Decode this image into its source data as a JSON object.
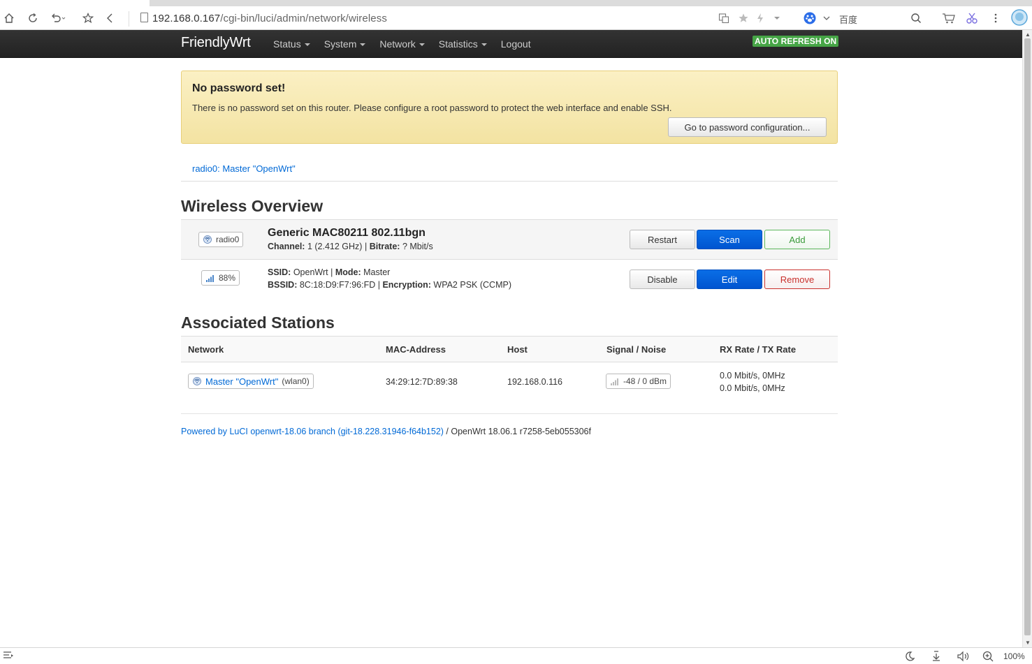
{
  "browser": {
    "url_host": "192.168.0.167",
    "url_path": "/cgi-bin/luci/admin/network/wireless",
    "search_engine_label": "百度",
    "zoom": "100%"
  },
  "navbar": {
    "brand": "FriendlyWrt",
    "items": [
      {
        "label": "Status",
        "dropdown": true
      },
      {
        "label": "System",
        "dropdown": true
      },
      {
        "label": "Network",
        "dropdown": true
      },
      {
        "label": "Statistics",
        "dropdown": true
      },
      {
        "label": "Logout",
        "dropdown": false
      }
    ],
    "auto_refresh": "AUTO REFRESH ON"
  },
  "alert": {
    "title": "No password set!",
    "message": "There is no password set on this router. Please configure a root password to protect the web interface and enable SSH.",
    "button": "Go to password configuration..."
  },
  "tabs": {
    "radio_tab": "radio0: Master \"OpenWrt\""
  },
  "wireless": {
    "title": "Wireless Overview",
    "device": {
      "badge": "radio0",
      "name": "Generic MAC80211 802.11bgn",
      "channel_label": "Channel:",
      "channel_value": "1 (2.412 GHz)",
      "bitrate_label": "Bitrate:",
      "bitrate_value": "? Mbit/s",
      "buttons": {
        "restart": "Restart",
        "scan": "Scan",
        "add": "Add"
      }
    },
    "network": {
      "signal_badge": "88%",
      "ssid_label": "SSID:",
      "ssid_value": "OpenWrt",
      "mode_label": "Mode:",
      "mode_value": "Master",
      "bssid_label": "BSSID:",
      "bssid_value": "8C:18:D9:F7:96:FD",
      "enc_label": "Encryption:",
      "enc_value": "WPA2 PSK (CCMP)",
      "buttons": {
        "disable": "Disable",
        "edit": "Edit",
        "remove": "Remove"
      }
    }
  },
  "stations": {
    "title": "Associated Stations",
    "headers": [
      "Network",
      "MAC-Address",
      "Host",
      "Signal / Noise",
      "RX Rate / TX Rate"
    ],
    "rows": [
      {
        "network_link": "Master \"OpenWrt\"",
        "network_iface": "(wlan0)",
        "mac": "34:29:12:7D:89:38",
        "host": "192.168.0.116",
        "signal": "-48 / 0 dBm",
        "rx_rate": "0.0 Mbit/s, 0MHz",
        "tx_rate": "0.0 Mbit/s, 0MHz"
      }
    ]
  },
  "footer": {
    "powered_link": "Powered by LuCI openwrt-18.06 branch (git-18.228.31946-f64b152)",
    "version": " / OpenWrt 18.06.1 r7258-5eb055306f"
  }
}
